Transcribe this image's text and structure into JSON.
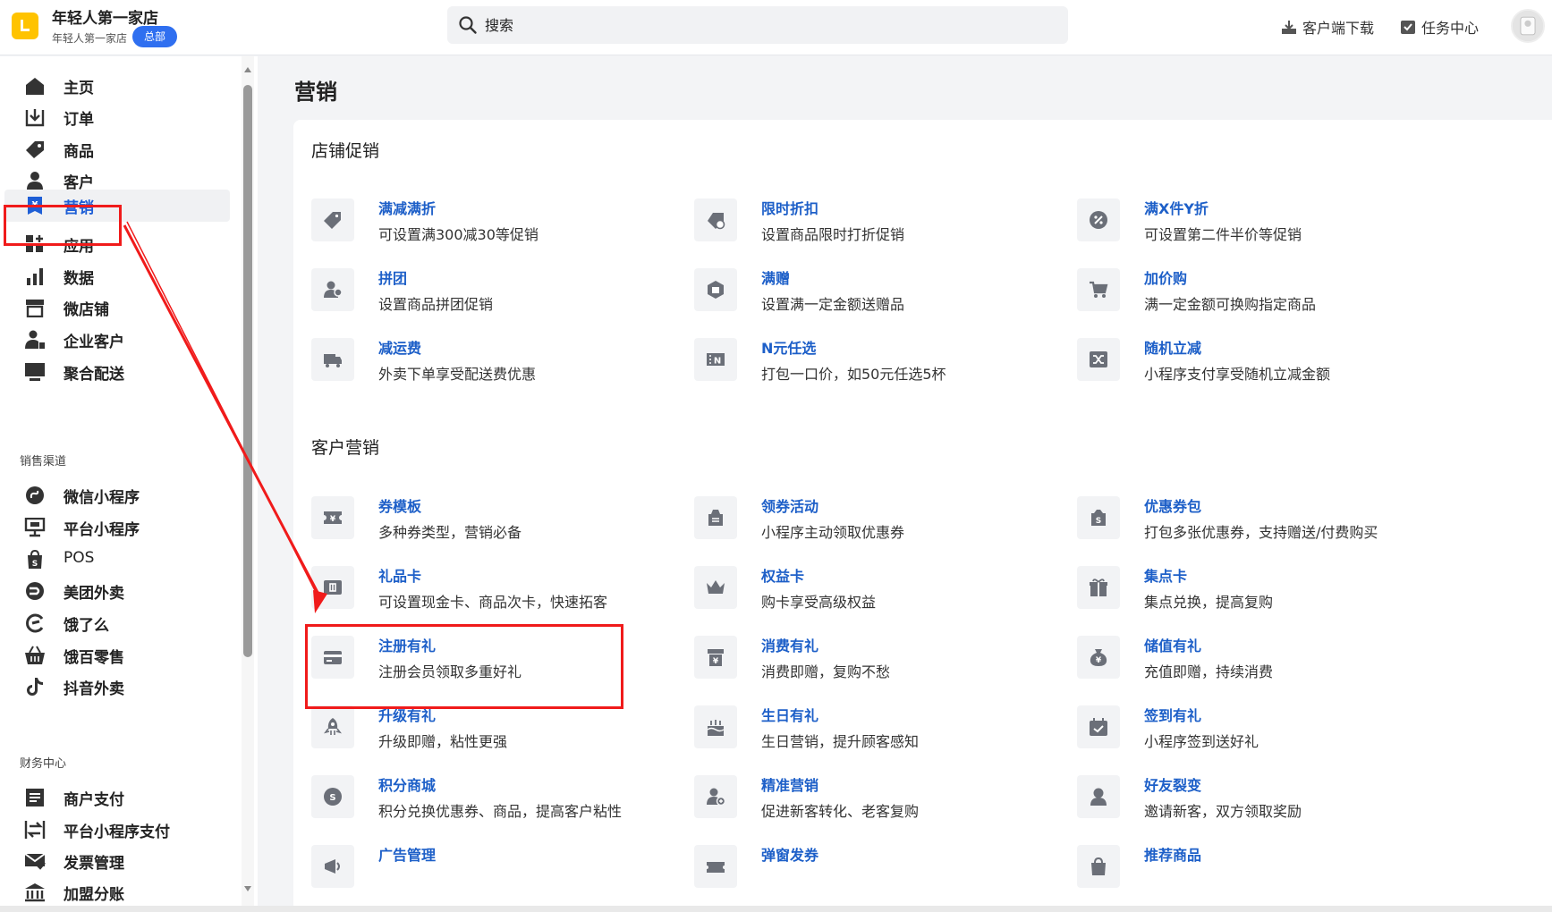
{
  "header": {
    "shop_name": "年轻人第一家店",
    "shop_sub": "年轻人第一家店",
    "badge": "总部",
    "search_placeholder": "搜索",
    "download_label": "客户端下载",
    "task_label": "任务中心"
  },
  "sidebar": {
    "main_items": [
      {
        "label": "主页",
        "icon": "home-icon"
      },
      {
        "label": "订单",
        "icon": "order-icon"
      },
      {
        "label": "商品",
        "icon": "tag-icon"
      },
      {
        "label": "客户",
        "icon": "user-icon"
      },
      {
        "label": "营销",
        "icon": "yen-bookmark-icon",
        "active": true
      },
      {
        "label": "应用",
        "icon": "apps-grid-icon"
      },
      {
        "label": "数据",
        "icon": "bar-chart-icon"
      },
      {
        "label": "微店铺",
        "icon": "store-icon"
      },
      {
        "label": "企业客户",
        "icon": "enterprise-user-icon"
      },
      {
        "label": "聚合配送",
        "icon": "monitor-icon"
      }
    ],
    "channel_label": "销售渠道",
    "channel_items": [
      {
        "label": "微信小程序",
        "icon": "mini-program-icon"
      },
      {
        "label": "平台小程序",
        "icon": "platform-icon"
      },
      {
        "label": "POS",
        "icon": "pos-bag-icon"
      },
      {
        "label": "美团外卖",
        "icon": "meituan-icon"
      },
      {
        "label": "饿了么",
        "icon": "eleme-icon"
      },
      {
        "label": "饿百零售",
        "icon": "basket-icon"
      },
      {
        "label": "抖音外卖",
        "icon": "douyin-icon"
      }
    ],
    "finance_label": "财务中心",
    "finance_items": [
      {
        "label": "商户支付",
        "icon": "document-icon"
      },
      {
        "label": "平台小程序支付",
        "icon": "transfer-icon"
      },
      {
        "label": "发票管理",
        "icon": "invoice-icon"
      },
      {
        "label": "加盟分账",
        "icon": "bank-icon"
      }
    ]
  },
  "main": {
    "title": "营销",
    "groups": [
      {
        "title": "店铺促销",
        "cards": [
          {
            "title": "满减满折",
            "desc": "可设置满300减30等促销",
            "icon": "tag-discount-icon"
          },
          {
            "title": "限时折扣",
            "desc": "设置商品限时打折促销",
            "icon": "timed-tag-icon"
          },
          {
            "title": "满X件Y折",
            "desc": "可设置第二件半价等促销",
            "icon": "percent-icon"
          },
          {
            "title": "拼团",
            "desc": "设置商品拼团促销",
            "icon": "group-users-icon"
          },
          {
            "title": "满赠",
            "desc": "设置满一定金额送赠品",
            "icon": "gift-hex-icon"
          },
          {
            "title": "加价购",
            "desc": "满一定金额可换购指定商品",
            "icon": "cart-icon"
          },
          {
            "title": "减运费",
            "desc": "外卖下单享受配送费优惠",
            "icon": "truck-icon"
          },
          {
            "title": "N元任选",
            "desc": "打包一口价，如50元任选5杯",
            "icon": "n-ticket-icon"
          },
          {
            "title": "随机立减",
            "desc": "小程序支付享受随机立减金额",
            "icon": "shuffle-icon"
          }
        ]
      },
      {
        "title": "客户营销",
        "cards": [
          {
            "title": "券模板",
            "desc": "多种券类型，营销必备",
            "icon": "coupon-icon"
          },
          {
            "title": "领券活动",
            "desc": "小程序主动领取优惠券",
            "icon": "coupon-bag-icon"
          },
          {
            "title": "优惠券包",
            "desc": "打包多张优惠券，支持赠送/付费购买",
            "icon": "coupon-pack-icon"
          },
          {
            "title": "礼品卡",
            "desc": "可设置现金卡、商品次卡，快速拓客",
            "icon": "gift-card-icon"
          },
          {
            "title": "权益卡",
            "desc": "购卡享受高级权益",
            "icon": "crown-icon"
          },
          {
            "title": "集点卡",
            "desc": "集点兑换，提高复购",
            "icon": "gift-box-icon"
          },
          {
            "title": "注册有礼",
            "desc": "注册会员领取多重好礼",
            "icon": "card-icon"
          },
          {
            "title": "消费有礼",
            "desc": "消费即赠，复购不愁",
            "icon": "yen-box-icon"
          },
          {
            "title": "储值有礼",
            "desc": "充值即赠，持续消费",
            "icon": "money-bag-icon"
          },
          {
            "title": "升级有礼",
            "desc": "升级即赠，粘性更强",
            "icon": "rocket-icon"
          },
          {
            "title": "生日有礼",
            "desc": "生日营销，提升顾客感知",
            "icon": "cake-icon"
          },
          {
            "title": "签到有礼",
            "desc": "小程序签到送好礼",
            "icon": "calendar-check-icon"
          },
          {
            "title": "积分商城",
            "desc": "积分兑换优惠券、商品，提高客户粘性",
            "icon": "points-coin-icon"
          },
          {
            "title": "精准营销",
            "desc": "促进新客转化、老客复购",
            "icon": "target-user-icon"
          },
          {
            "title": "好友裂变",
            "desc": "邀请新客，双方领取奖励",
            "icon": "friend-icon"
          },
          {
            "title": "广告管理",
            "desc": "",
            "icon": "ad-icon"
          },
          {
            "title": "弹窗发券",
            "desc": "",
            "icon": "popup-coupon-icon"
          },
          {
            "title": "推荐商品",
            "desc": "",
            "icon": "recommend-bag-icon"
          }
        ]
      }
    ]
  },
  "colors": {
    "accent_blue": "#1d5fc8",
    "brand_yellow": "#ffc300",
    "annotation_red": "#f01b1b"
  }
}
